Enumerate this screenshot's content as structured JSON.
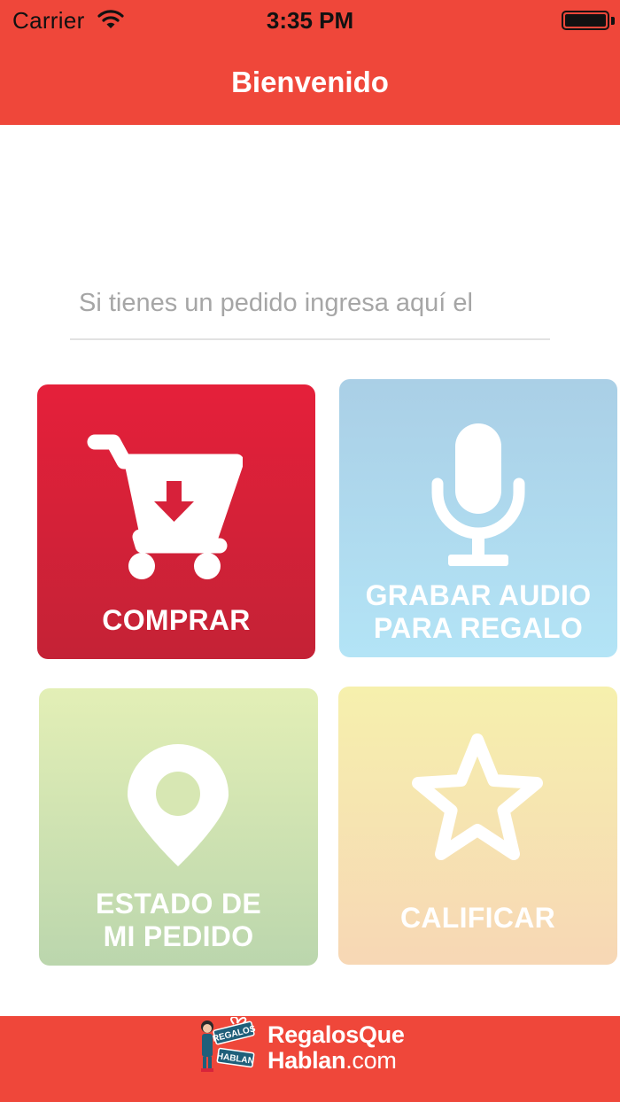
{
  "status_bar": {
    "carrier": "Carrier",
    "time": "3:35 PM"
  },
  "nav": {
    "title": "Bienvenido"
  },
  "order": {
    "placeholder": "Si tienes un pedido ingresa aquí el"
  },
  "tiles": {
    "comprar": {
      "label": "COMPRAR",
      "icon": "cart-download-icon"
    },
    "audio": {
      "line1": "GRABAR AUDIO",
      "line2": "PARA REGALO",
      "icon": "microphone-icon"
    },
    "estado": {
      "line1": "ESTADO DE",
      "line2": "MI PEDIDO",
      "icon": "map-pin-icon"
    },
    "calificar": {
      "label": "CALIFICAR",
      "icon": "star-icon"
    }
  },
  "footer": {
    "brand_line1": "RegalosQue",
    "brand_line2": "Hablan",
    "brand_line2_suffix": ".com",
    "badge_top": "REGALOS",
    "badge_bottom": "HABLAN"
  },
  "colors": {
    "header": "#ef473a",
    "comprar": "#d62237",
    "audio": "#b0dcf0",
    "estado": "#d3e4b2",
    "calificar": "#f7e3b0"
  }
}
